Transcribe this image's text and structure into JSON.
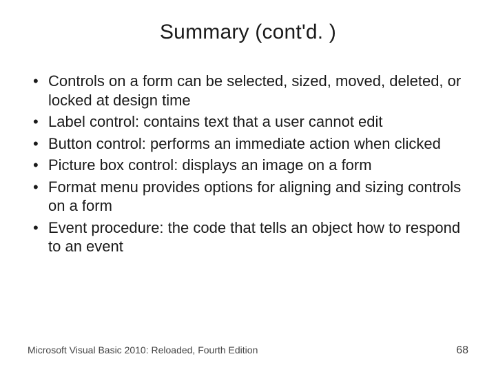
{
  "title": "Summary (cont'd. )",
  "bullets": [
    "Controls on a form can be selected, sized, moved, deleted, or locked at design time",
    "Label control: contains text that a user cannot edit",
    "Button control: performs an immediate action when clicked",
    "Picture box control: displays an image on a form",
    "Format menu provides options for aligning and sizing controls on a form",
    "Event procedure: the code that tells an object how to respond to an event"
  ],
  "footer": {
    "source": "Microsoft Visual Basic 2010: Reloaded, Fourth Edition",
    "page": "68"
  }
}
